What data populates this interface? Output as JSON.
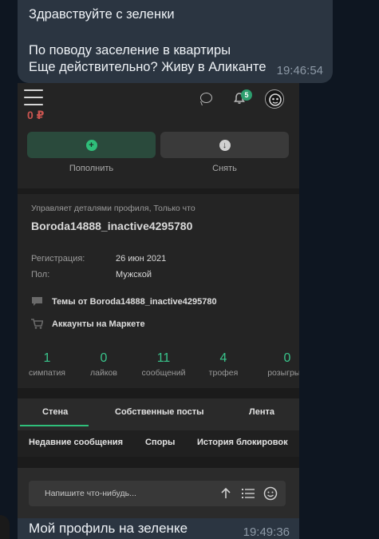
{
  "chat": {
    "message_line1": "Здравствуйте с зеленки",
    "message_line2": "По поводу заселение в квартиры",
    "message_line3": "Еще действительно? Живу в Аликанте",
    "message_time": "19:46:54",
    "caption": "Мой профиль на зеленке",
    "caption_time": "19:49:36"
  },
  "header": {
    "notifications_count": "5"
  },
  "balance": "0 ₽",
  "actions": {
    "deposit_icon": "+",
    "deposit_label": "Пополнить",
    "withdraw_icon": "↓",
    "withdraw_label": "Снять"
  },
  "profile": {
    "manages": "Управляет деталями профиля, Только что",
    "username": "Boroda14888_inactive4295780",
    "reg_label": "Регистрация:",
    "reg_value": "26 июн 2021",
    "gender_label": "Пол:",
    "gender_value": "Мужской",
    "threads_link": "Темы от Boroda14888_inactive4295780",
    "market_link": "Аккаунты на Маркете"
  },
  "stats": [
    {
      "value": "1",
      "label": "симпатия"
    },
    {
      "value": "0",
      "label": "лайков"
    },
    {
      "value": "11",
      "label": "сообщений"
    },
    {
      "value": "4",
      "label": "трофея"
    },
    {
      "value": "0",
      "label": "розыгрыш"
    }
  ],
  "tabs_primary": [
    "Стена",
    "Собственные посты",
    "Лента"
  ],
  "tabs_secondary": [
    "Недавние сообщения",
    "Споры",
    "История блокировок"
  ],
  "composer": {
    "placeholder": "Напишите что-нибудь..."
  },
  "colors": {
    "accent": "#2fbf7a",
    "telegram_bubble": "#2b3541",
    "app_bg": "#242424"
  },
  "icons": [
    "menu-icon",
    "chat-icon",
    "bell-icon",
    "avatar",
    "plus-icon",
    "download-icon",
    "comment-icon",
    "cart-icon",
    "send-icon",
    "list-icon",
    "smile-icon"
  ]
}
